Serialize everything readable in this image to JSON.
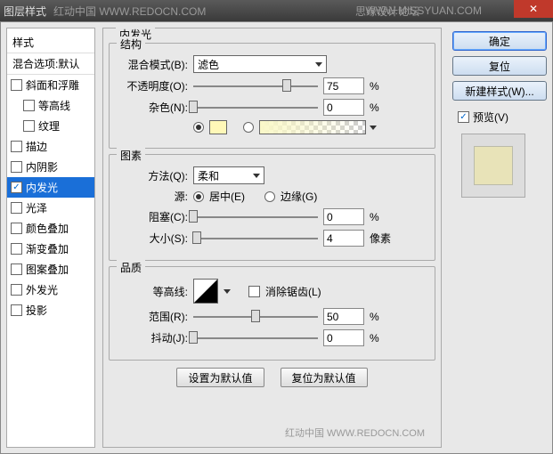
{
  "titlebar": {
    "title": "图层样式",
    "wm1": "红动中国 WWW.REDOCN.COM",
    "wm2": "WWW.MISSYUAN.COM",
    "wm3": "思缘设计论坛"
  },
  "left": {
    "header": "样式",
    "sub": "混合选项:默认",
    "items": [
      {
        "label": "斜面和浮雕",
        "checked": false
      },
      {
        "label": "等高线",
        "checked": false,
        "child": true
      },
      {
        "label": "纹理",
        "checked": false,
        "child": true
      },
      {
        "label": "描边",
        "checked": false
      },
      {
        "label": "内阴影",
        "checked": false
      },
      {
        "label": "内发光",
        "checked": true,
        "selected": true
      },
      {
        "label": "光泽",
        "checked": false
      },
      {
        "label": "颜色叠加",
        "checked": false
      },
      {
        "label": "渐变叠加",
        "checked": false
      },
      {
        "label": "图案叠加",
        "checked": false
      },
      {
        "label": "外发光",
        "checked": false
      },
      {
        "label": "投影",
        "checked": false
      }
    ]
  },
  "mid": {
    "title": "内发光",
    "struct": {
      "title": "结构",
      "blend_lbl": "混合模式(B):",
      "blend_val": "滤色",
      "opac_lbl": "不透明度(O):",
      "opac_val": "75",
      "opac_pct": 75,
      "unit": "%",
      "noise_lbl": "杂色(N):",
      "noise_val": "0",
      "noise_pct": 0,
      "color": "#fff8b8"
    },
    "elem": {
      "title": "图素",
      "tech_lbl": "方法(Q):",
      "tech_val": "柔和",
      "src_lbl": "源:",
      "src_center": "居中(E)",
      "src_edge": "边缘(G)",
      "choke_lbl": "阻塞(C):",
      "choke_val": "0",
      "choke_pct": 0,
      "unit_pct": "%",
      "size_lbl": "大小(S):",
      "size_val": "4",
      "size_pct": 3,
      "unit_px": "像素"
    },
    "qual": {
      "title": "品质",
      "contour_lbl": "等高线:",
      "aa_lbl": "消除锯齿(L)",
      "range_lbl": "范围(R):",
      "range_val": "50",
      "range_pct": 50,
      "jitter_lbl": "抖动(J):",
      "jitter_val": "0",
      "jitter_pct": 0,
      "unit": "%"
    },
    "defaults": {
      "set": "设置为默认值",
      "reset": "复位为默认值"
    }
  },
  "right": {
    "ok": "确定",
    "cancel": "复位",
    "newstyle": "新建样式(W)...",
    "preview": "预览(V)"
  },
  "footer": "红动中国 WWW.REDOCN.COM"
}
